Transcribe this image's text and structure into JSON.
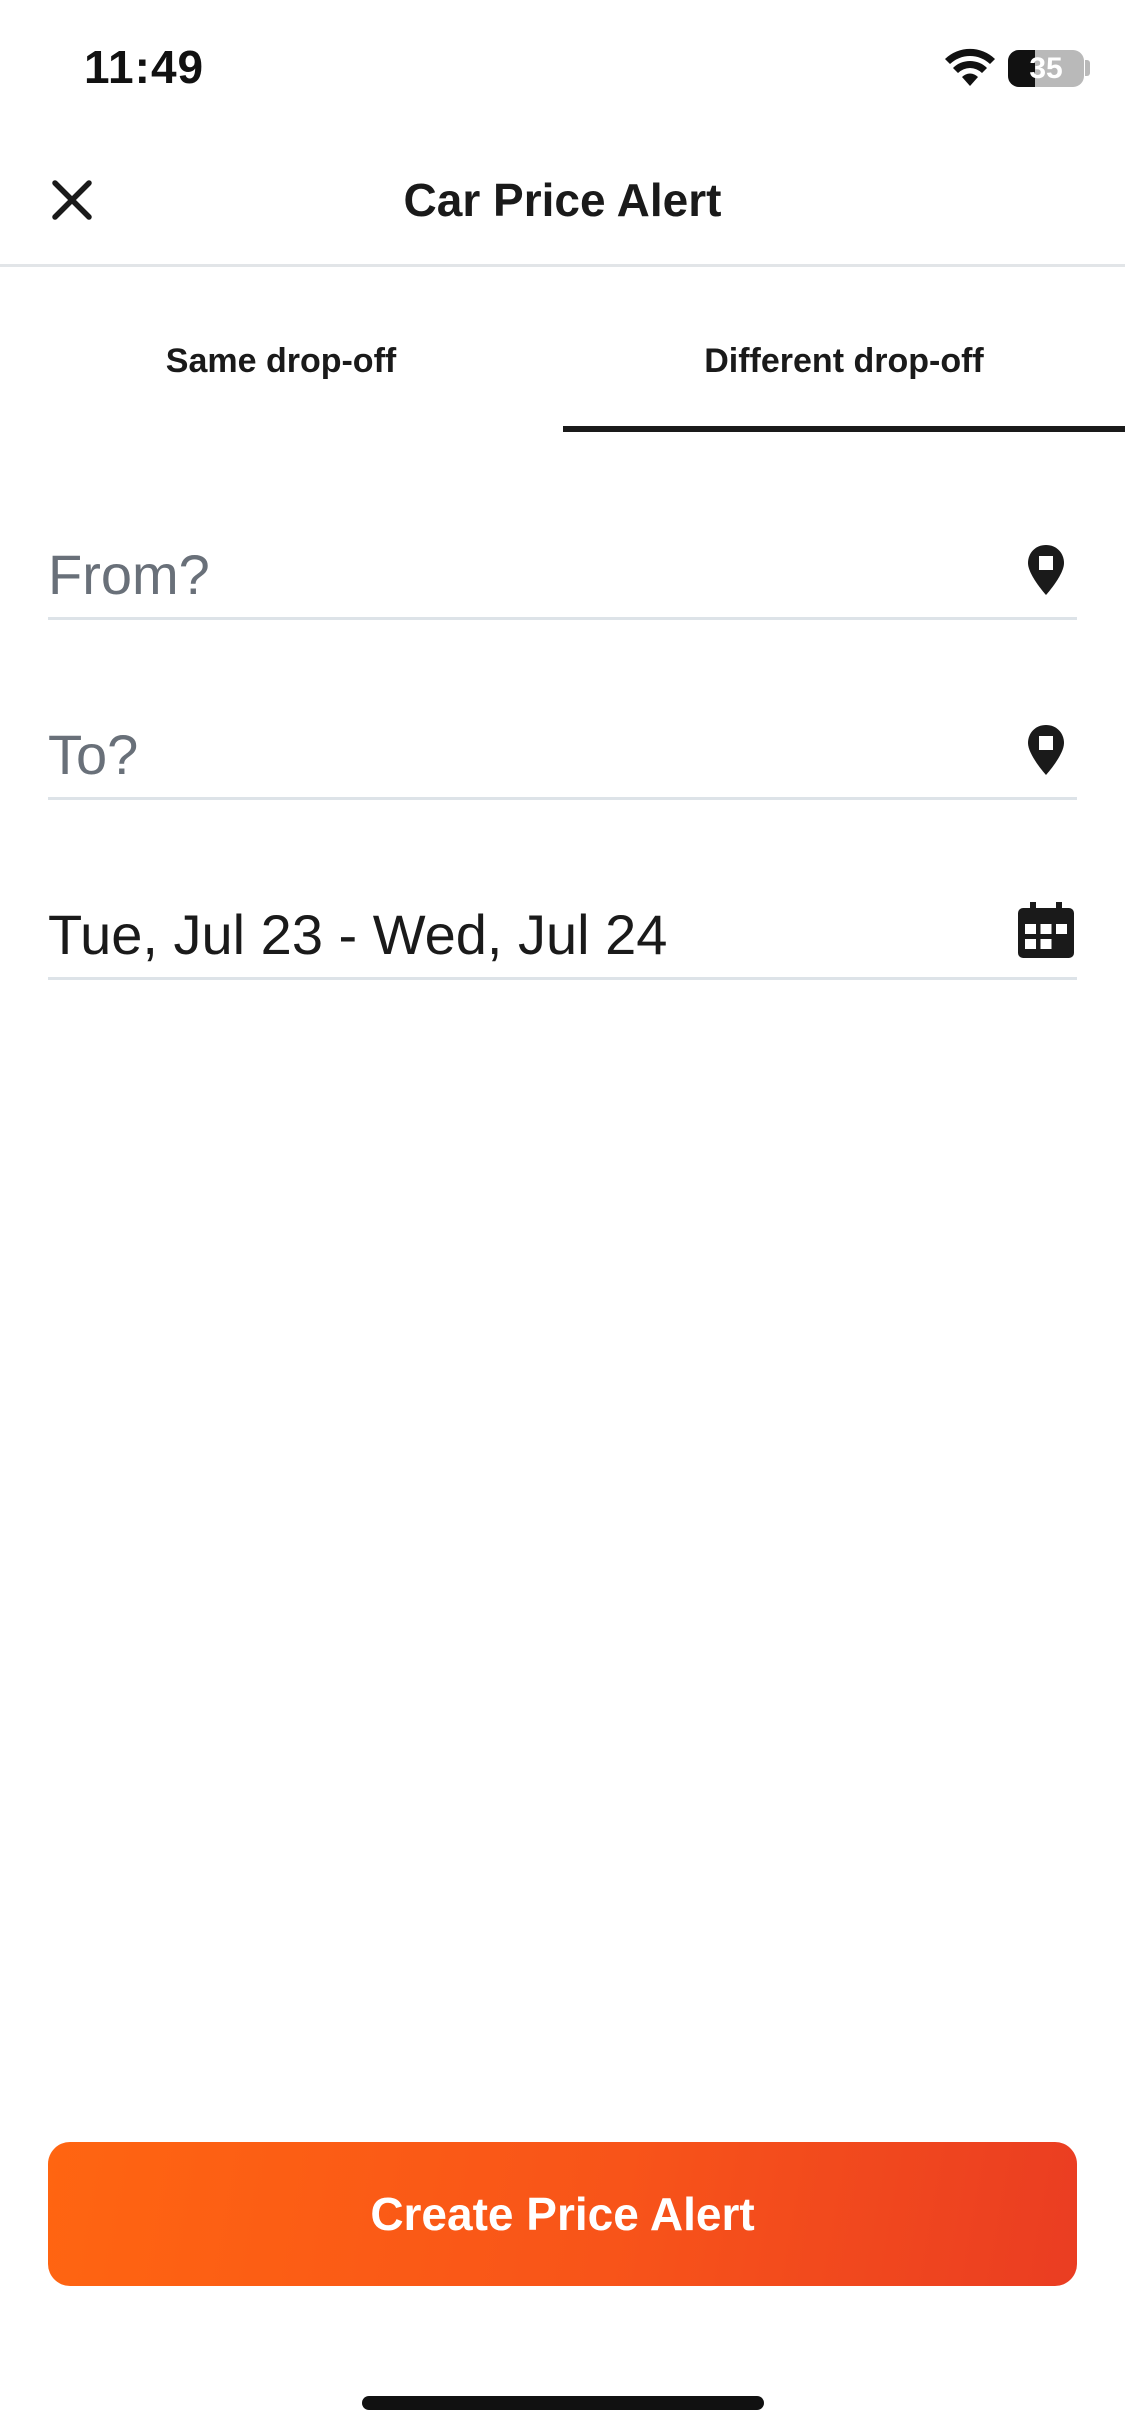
{
  "status_bar": {
    "time": "11:49",
    "battery_level": "35",
    "battery_fraction": 0.35,
    "wifi_icon": "wifi-icon"
  },
  "header": {
    "title": "Car Price Alert",
    "close_icon": "close-icon"
  },
  "tabs": [
    {
      "label": "Same drop-off",
      "active": false
    },
    {
      "label": "Different drop-off",
      "active": true
    }
  ],
  "form": {
    "from": {
      "value": "",
      "placeholder": "From?",
      "icon": "map-pin-icon"
    },
    "to": {
      "value": "",
      "placeholder": "To?",
      "icon": "map-pin-icon"
    },
    "dates": {
      "value": "Tue, Jul 23 - Wed, Jul 24",
      "icon": "calendar-icon"
    }
  },
  "actions": {
    "create_label": "Create Price Alert"
  },
  "colors": {
    "accent": "#ff6511",
    "accent_end": "#ea3d22",
    "text": "#1a1a1a",
    "placeholder": "#697079",
    "divider": "#dde3e8"
  }
}
